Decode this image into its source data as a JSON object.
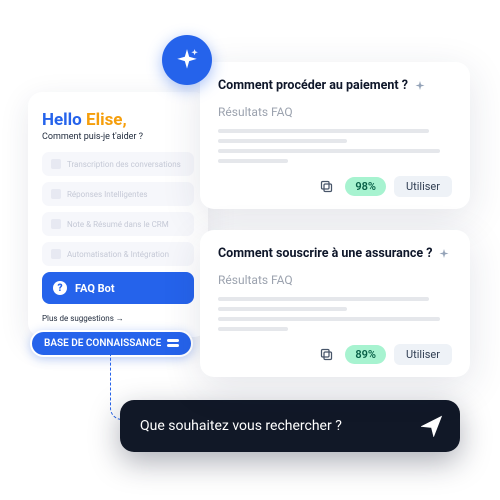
{
  "left": {
    "hello1": "Hello ",
    "hello2": "Elise,",
    "subtitle": "Comment puis-je t'aider ?",
    "suggestions": [
      "Transcription des conversations",
      "Réponses Intelligentes",
      "Note & Résumé dans le CRM",
      "Automatisation & Intégration"
    ],
    "faq_bot": "FAQ Bot",
    "more": "Plus de suggestions  →"
  },
  "kb_label": "BASE DE CONNAISSANCE",
  "search_placeholder": "Que souhaitez vous rechercher ?",
  "results_label": "Résultats FAQ",
  "card1": {
    "question": "Comment procéder au paiement ?",
    "pct": "98%",
    "use": "Utiliser"
  },
  "card2": {
    "question": "Comment souscrire à une assurance ?",
    "pct": "89%",
    "use": "Utiliser"
  }
}
